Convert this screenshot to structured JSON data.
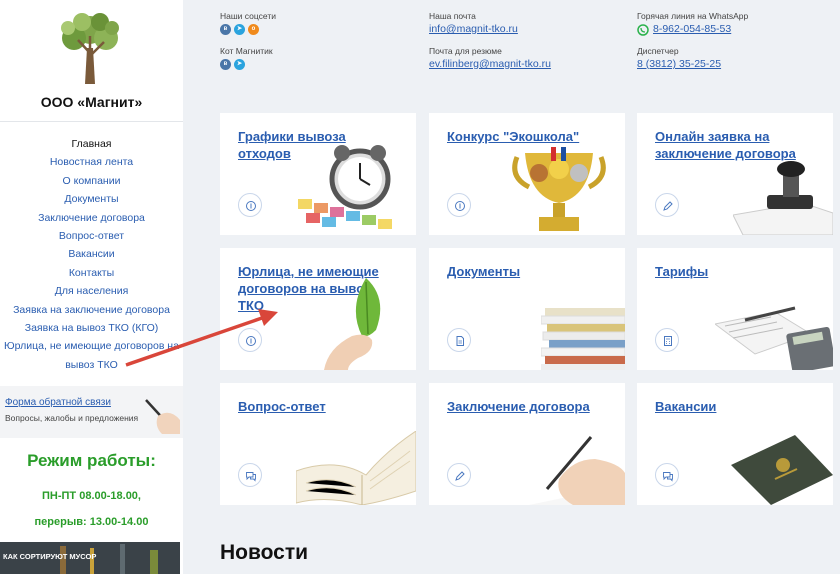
{
  "sidebar": {
    "company": "ООО «Магнит»",
    "menu": [
      "Главная",
      "Новостная лента",
      "О компании",
      "Документы",
      "Заключение договора",
      "Вопрос-ответ",
      "Вакансии",
      "Контакты",
      "Для населения",
      "Заявка на заключение договора",
      "Заявка на вывоз ТКО (КГО)",
      "Юрлица, не имеющие договоров на вывоз ТКО"
    ],
    "feedback_link": "Форма обратной связи",
    "feedback_sub": "Вопросы, жалобы и предложения",
    "hours_title": "Режим работы:",
    "hours_days": "ПН-ПТ 08.00-18.00,",
    "hours_break": "перерыв: 13.00-14.00",
    "banner_text": "КАК СОРТИРУЮТ МУСОР"
  },
  "header": {
    "social_label": "Наши соцсети",
    "cat_label": "Кот Магнитик",
    "mail_label": "Наша почта",
    "mail": "info@magnit-tko.ru",
    "resume_label": "Почта для резюме",
    "resume_mail": "ev.filinberg@magnit-tko.ru",
    "whatsapp_label": "Горячая линия на WhatsApp",
    "whatsapp_phone": "8-962-054-85-53",
    "dispatcher_label": "Диспетчер",
    "dispatcher_phone": "8 (3812) 35-25-25"
  },
  "tiles": [
    {
      "title": "Графики вывоза отходов",
      "icon": "coin-icon"
    },
    {
      "title": "Конкурс \"Экошкола\"",
      "icon": "coin-icon"
    },
    {
      "title": "Онлайн заявка на заключение договора",
      "icon": "pen-icon"
    },
    {
      "title": "Юрлица, не имеющие договоров на вывоз ТКО",
      "icon": "coin-icon"
    },
    {
      "title": "Документы",
      "icon": "document-icon"
    },
    {
      "title": "Тарифы",
      "icon": "calculator-icon"
    },
    {
      "title": "Вопрос-ответ",
      "icon": "chat-icon"
    },
    {
      "title": "Заключение договора",
      "icon": "pen-icon"
    },
    {
      "title": "Вакансии",
      "icon": "chat-icon"
    }
  ],
  "news_title": "Новости",
  "colors": {
    "link": "#2a5db0",
    "accent_green": "#2a9d2a",
    "arrow": "#d9463a"
  }
}
